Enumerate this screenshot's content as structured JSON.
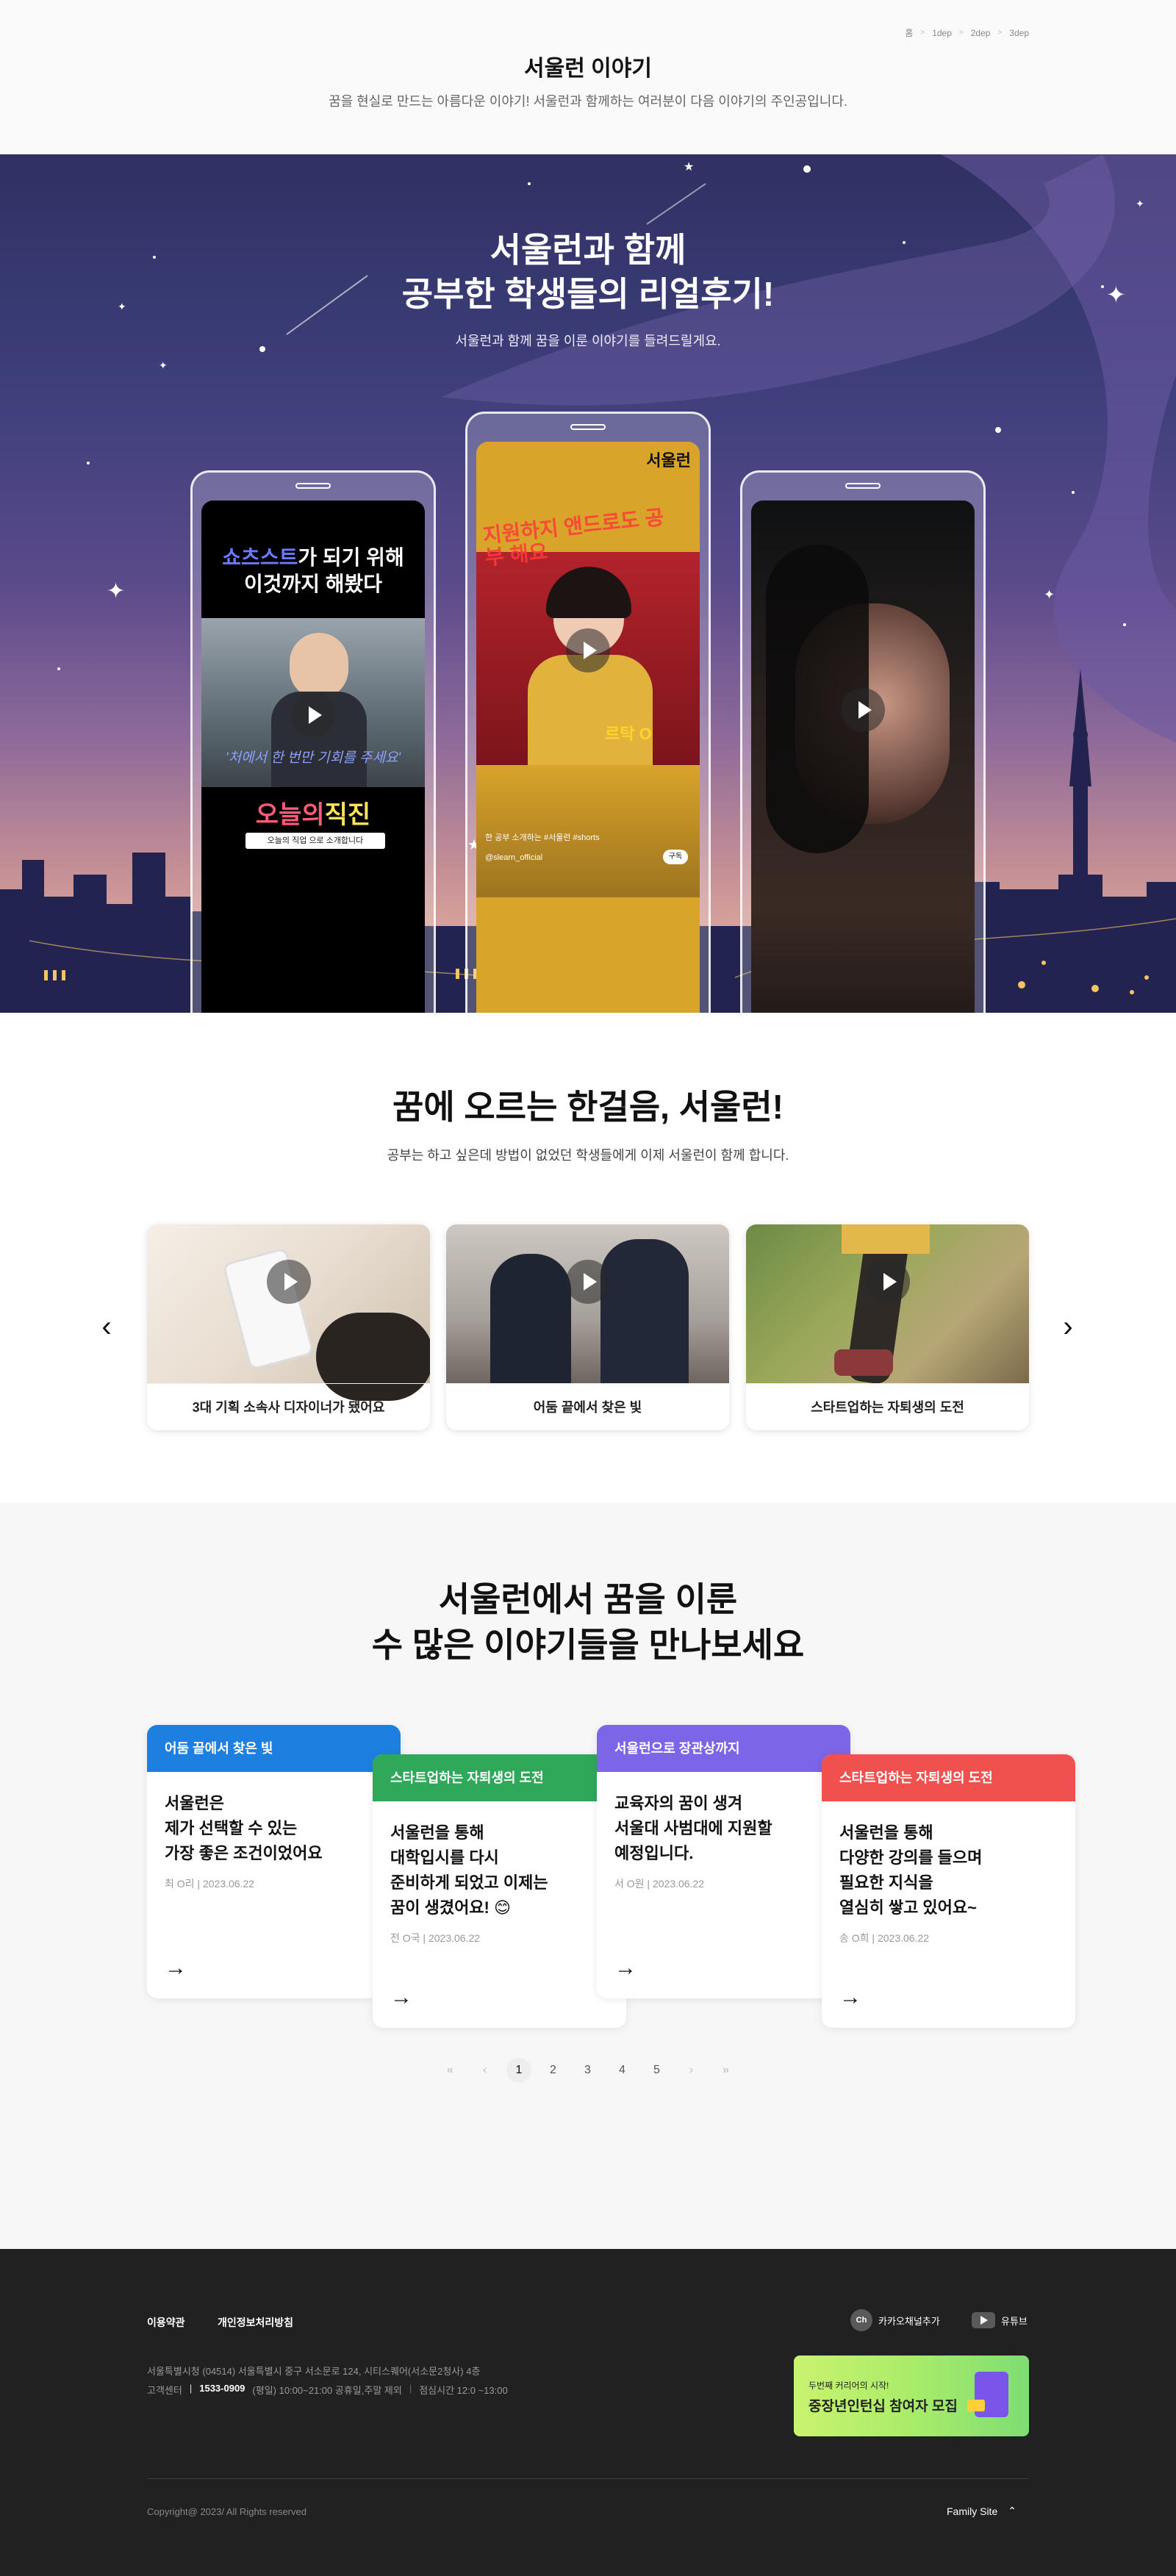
{
  "breadcrumb": {
    "items": [
      "홈",
      "1dep",
      "2dep",
      "3dep"
    ]
  },
  "header": {
    "title": "서울런 이야기",
    "subtitle": "꿈을 현실로 만드는 아름다운 이야기! 서울런과 함께하는 여러분이 다음 이야기의 주인공입니다."
  },
  "hero": {
    "title_line1": "서울런과 함께",
    "title_line2": "공부한 학생들의 리얼후기!",
    "subtitle": "서울런과 함께 꿈을 이룬 이야기를 들려드릴게요.",
    "phone1": {
      "line1_a": "쇼츠스트",
      "line1_b": "가 되기 위해",
      "line2": "이것까지 해봤다",
      "caption": "'처에서 한 번만 기회를 주세요'",
      "brand_a": "오늘의",
      "brand_b": "직진",
      "brand_sub": "오늘의 직업 으로 소개합니다"
    },
    "phone2": {
      "logo": "서울런",
      "overlay_text": "지원하지 앤드로도 공부 해요",
      "sticker": "르탁 O",
      "footer_line1": "한 공부 소개하는 #서울런 #shorts",
      "footer_line2": "@slearn_official",
      "subscribe": "구독"
    }
  },
  "section2": {
    "title": "꿈에 오르는 한걸음, 서울런!",
    "subtitle": "공부는 하고 싶은데 방법이 없었던 학생들에게 이제 서울런이 함께 합니다.",
    "videos": [
      {
        "caption": "3대 기획 소속사 디자이너가 됐어요"
      },
      {
        "caption": "어둠 끝에서 찾은 빛"
      },
      {
        "caption": "스타트업하는 자퇴생의 도전"
      }
    ],
    "prev_icon": "chevron-left-icon",
    "next_icon": "chevron-right-icon"
  },
  "section3": {
    "title_line1": "서울런에서 꿈을 이룬",
    "title_line2": "수 많은 이야기들을 만나보세요",
    "stories": [
      {
        "tag": "어둠 끝에서 찾은 빛",
        "color": "#1d7fe0",
        "lines": [
          "서울런은",
          "제가 선택할 수 있는",
          "가장 좋은 조건이었어요"
        ],
        "meta": "최 O리 | 2023.06.22"
      },
      {
        "tag": "스타트업하는 자퇴생의 도전",
        "color": "#2fa85a",
        "lines": [
          "서울런을 통해",
          "대학입시를 다시",
          "준비하게 되었고 이제는",
          "꿈이 생겼어요! 😊"
        ],
        "meta": "전 O국 | 2023.06.22"
      },
      {
        "tag": "서울런으로 장관상까지",
        "color": "#7c65e6",
        "lines": [
          "교육자의 꿈이 생겨",
          "서울대 사범대에 지원할",
          "예정입니다."
        ],
        "meta": "서 O원 | 2023.06.22"
      },
      {
        "tag": "스타트업하는 자퇴생의 도전",
        "color": "#f0514f",
        "lines": [
          "서울런을 통해",
          "다양한 강의를 들으며",
          "필요한 지식을",
          "열심히 쌓고 있어요~"
        ],
        "meta": "송 O희 | 2023.06.22"
      }
    ],
    "pagination": {
      "first": "«",
      "prev": "‹",
      "pages": [
        "1",
        "2",
        "3",
        "4",
        "5"
      ],
      "current": "1",
      "next": "›",
      "last": "»"
    }
  },
  "footer": {
    "links": [
      "이용약관",
      "개인정보처리방침"
    ],
    "social": [
      {
        "icon": "kakao-channel-icon",
        "badge": "Ch",
        "label": "카카오채널추가"
      },
      {
        "icon": "youtube-icon",
        "label": "유튜브"
      }
    ],
    "address": "서울특별시청 (04514) 서울특별시 중구 서소문로 124, 시티스퀘어(서소문2청사) 4층",
    "cs_label": "고객센터",
    "cs_phone": "1533-0909",
    "cs_hours": "(평일) 10:00~21:00 공휴일,주말 제외",
    "lunch": "점심시간 12:0 ~13:00",
    "banner_small": "두번째 커리어의 시작!",
    "banner_big": "중장년인턴십 참여자 모집",
    "copyright": "Copyright@ 2023/ All Rights reserved",
    "family_site": "Family Site",
    "family_icon": "chevron-up-icon"
  }
}
